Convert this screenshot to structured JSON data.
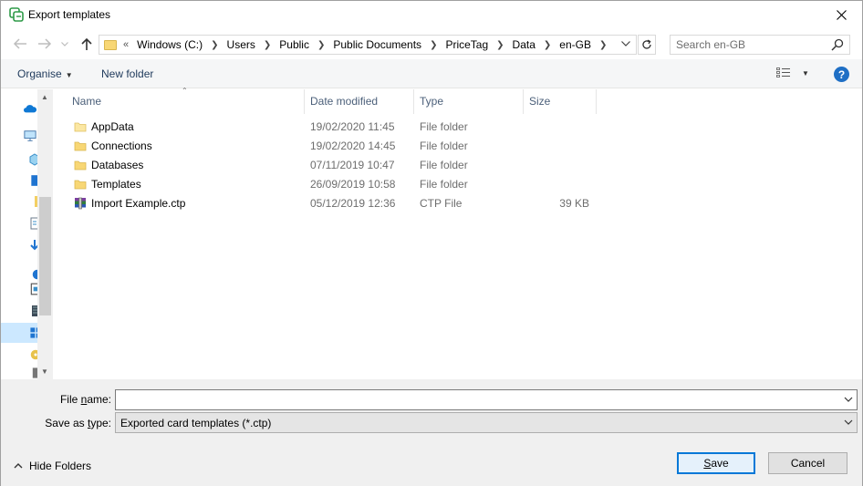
{
  "window": {
    "title": "Export templates"
  },
  "address": {
    "overflow": "«",
    "breadcrumbs": [
      "Windows (C:)",
      "Users",
      "Public",
      "Public Documents",
      "PriceTag",
      "Data",
      "en-GB"
    ]
  },
  "search": {
    "placeholder": "Search en-GB"
  },
  "toolbar": {
    "organise": "Organise",
    "new_folder": "New folder",
    "help": "?"
  },
  "columns": {
    "name": "Name",
    "date": "Date modified",
    "type": "Type",
    "size": "Size"
  },
  "files": [
    {
      "name": "AppData",
      "date": "19/02/2020 11:45",
      "type": "File folder",
      "size": "",
      "icon": "folder-icon"
    },
    {
      "name": "Connections",
      "date": "19/02/2020 14:45",
      "type": "File folder",
      "size": "",
      "icon": "folder-icon"
    },
    {
      "name": "Databases",
      "date": "07/11/2019 10:47",
      "type": "File folder",
      "size": "",
      "icon": "folder-icon"
    },
    {
      "name": "Templates",
      "date": "26/09/2019 10:58",
      "type": "File folder",
      "size": "",
      "icon": "folder-icon"
    },
    {
      "name": "Import Example.ctp",
      "date": "05/12/2019 12:36",
      "type": "CTP File",
      "size": "39 KB",
      "icon": "archive-file-icon"
    }
  ],
  "form": {
    "file_name_label_pre": "File ",
    "file_name_label_ul": "n",
    "file_name_label_post": "ame:",
    "file_name_value": "",
    "save_type_label_pre": "Save as ",
    "save_type_label_ul": "t",
    "save_type_label_post": "ype:",
    "save_type_value": "Exported card templates (*.ctp)"
  },
  "buttons": {
    "hide_folders": "Hide Folders",
    "save_ul": "S",
    "save_rest": "ave",
    "cancel": "Cancel"
  },
  "colors": {
    "accent": "#0078d7",
    "folder": "#f8d775",
    "help": "#1f6fc5"
  }
}
